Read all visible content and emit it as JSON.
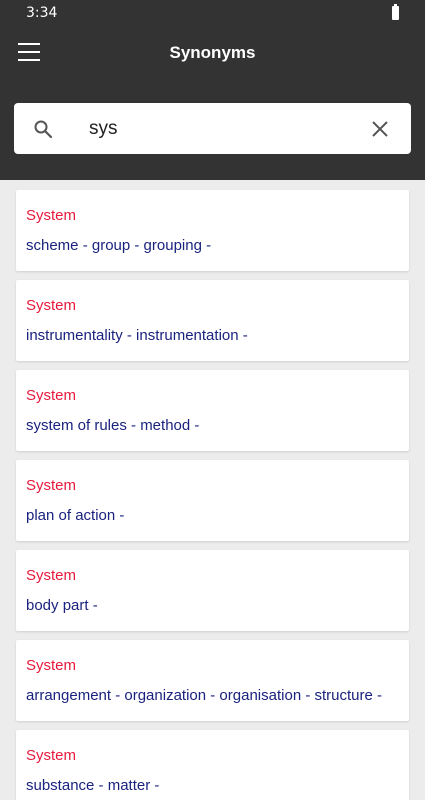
{
  "status_bar": {
    "time": "3:34"
  },
  "app_bar": {
    "title": "Synonyms"
  },
  "search": {
    "value": "sys"
  },
  "results": [
    {
      "word": "System",
      "synonyms": "scheme - group - grouping -"
    },
    {
      "word": "System",
      "synonyms": "instrumentality - instrumentation -"
    },
    {
      "word": "System",
      "synonyms": "system of rules - method -"
    },
    {
      "word": "System",
      "synonyms": "plan of action -"
    },
    {
      "word": "System",
      "synonyms": "body part -"
    },
    {
      "word": "System",
      "synonyms": "arrangement - organization - organisation - structure -"
    },
    {
      "word": "System",
      "synonyms": "substance - matter -"
    }
  ],
  "icons": {
    "menu": "menu-icon",
    "search": "search-icon",
    "clear": "close-icon",
    "battery": "battery-icon"
  },
  "colors": {
    "app_bar": "#333333",
    "word": "#e8193c",
    "synonyms": "#1a237e",
    "background": "#ececec"
  }
}
